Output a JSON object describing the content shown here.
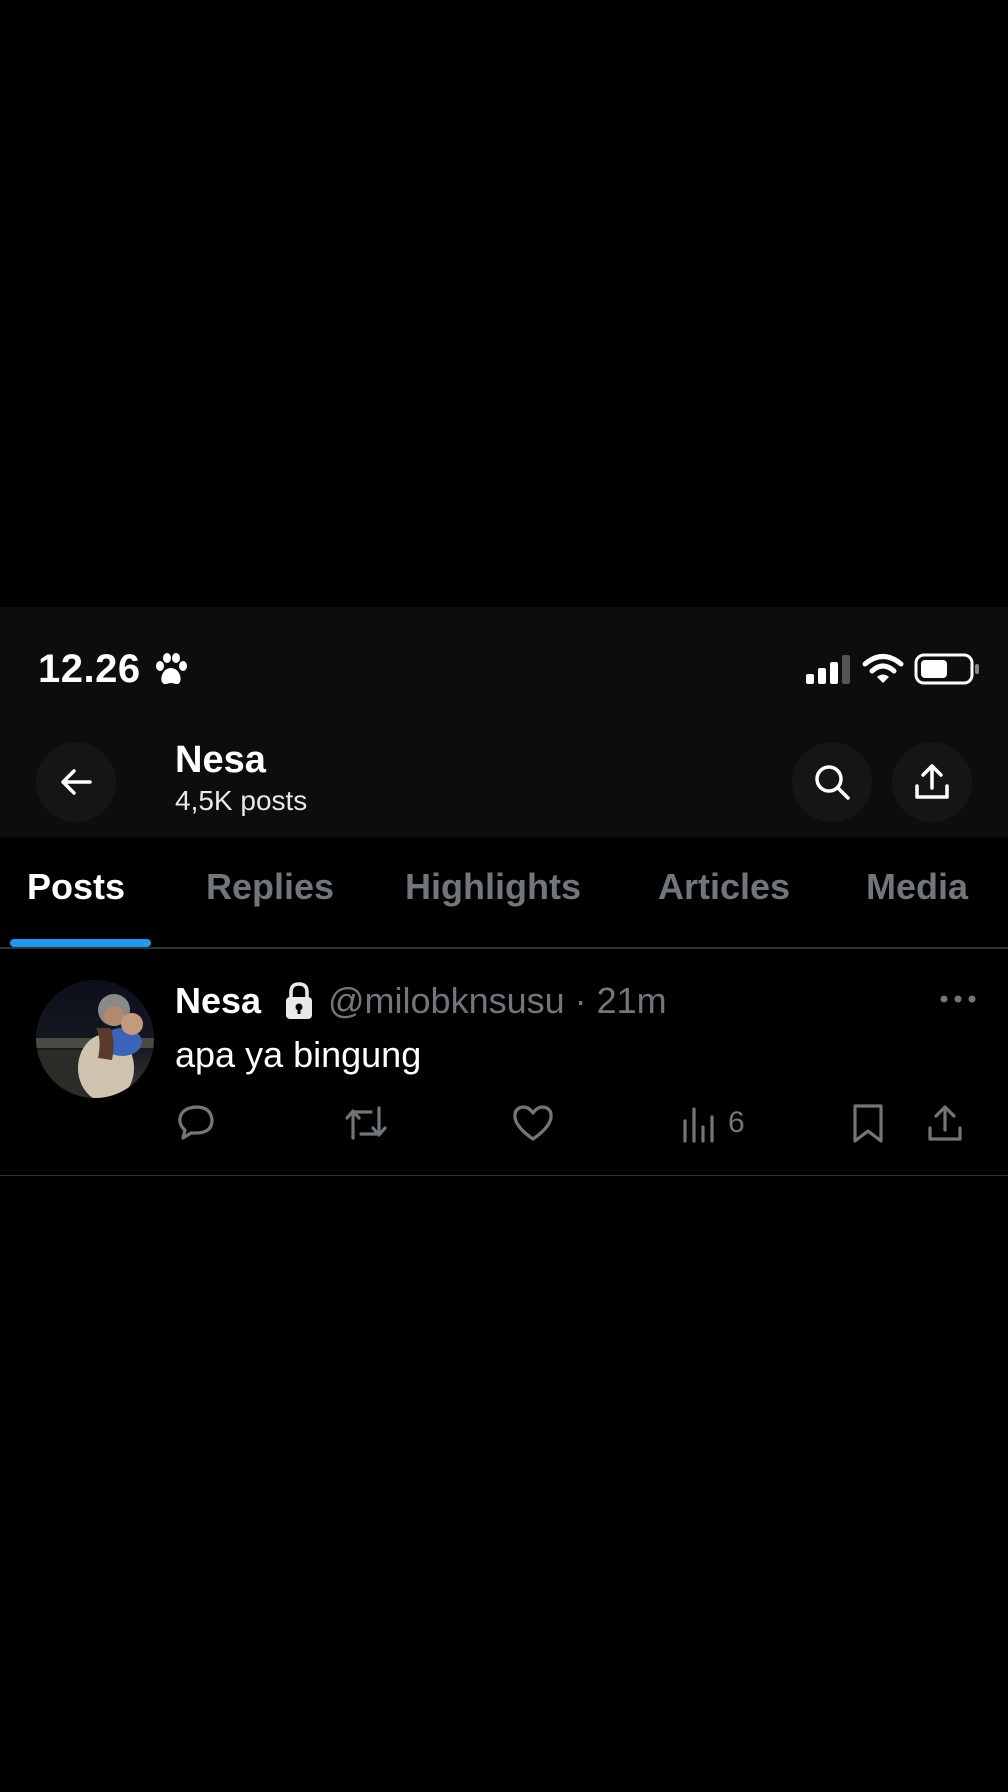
{
  "status_bar": {
    "time": "12.26",
    "icons": [
      "paw-icon",
      "cellular-signal-icon",
      "wifi-icon",
      "battery-icon"
    ]
  },
  "header": {
    "name": "Nesa",
    "posts_count": "4,5K posts",
    "icons": [
      "back-arrow-icon",
      "search-icon",
      "share-icon"
    ]
  },
  "tabs": [
    {
      "label": "Posts",
      "active": true
    },
    {
      "label": "Replies",
      "active": false
    },
    {
      "label": "Highlights",
      "active": false
    },
    {
      "label": "Articles",
      "active": false
    },
    {
      "label": "Media",
      "active": false
    }
  ],
  "post": {
    "author": "Nesa",
    "handle_time": "@milobknsusu · 21m",
    "text": "apa ya bingung",
    "views": "6",
    "icons": [
      "reply-icon",
      "repost-icon",
      "like-icon",
      "views-icon",
      "bookmark-icon",
      "share-icon",
      "more-icon",
      "lock-icon"
    ]
  },
  "colors": {
    "background": "#000000",
    "header_bg": "#0d0d0d",
    "accent": "#1d9bf0",
    "secondary_text": "#71767b",
    "primary_text": "#ffffff"
  }
}
